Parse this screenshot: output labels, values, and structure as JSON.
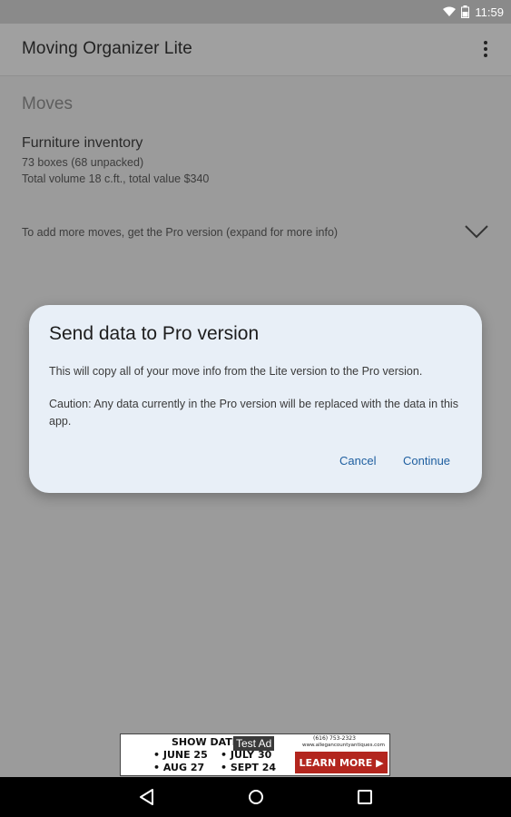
{
  "status_bar": {
    "time": "11:59",
    "icons": [
      "wifi-icon",
      "battery-icon"
    ]
  },
  "app_bar": {
    "title": "Moving Organizer Lite",
    "menu_icon": "overflow-menu-icon"
  },
  "moves": {
    "section_title": "Moves",
    "items": [
      {
        "name": "Furniture inventory",
        "line1": "73 boxes (68 unpacked)",
        "line2": "Total volume 18 c.ft., total value $340"
      }
    ],
    "pro_prompt": "To add more moves, get the Pro version (expand for more info)",
    "expand_icon": "chevron-down-icon"
  },
  "dialog": {
    "title": "Send data to Pro version",
    "body1": "This will copy all of your move info from the Lite version to the Pro version.",
    "body2": "Caution: Any data currently in the Pro version will be replaced with the data in this app.",
    "cancel_label": "Cancel",
    "continue_label": "Continue"
  },
  "ad": {
    "badge": "Test Ad",
    "headline": "SHOW DATES",
    "dates": [
      "• JUNE 25",
      "• AUG 27",
      "• JULY 30",
      "• SEPT 24"
    ],
    "phone": "(616) 753-2323",
    "url": "www.allegancountyantiques.com",
    "cta": "LEARN MORE ▶"
  },
  "nav_bar": {
    "icons": [
      "back-icon",
      "home-icon",
      "recents-icon"
    ]
  },
  "colors": {
    "dialog_bg": "#e8eff7",
    "button_text": "#1f5fa0",
    "scrim": "#9b9b9b"
  }
}
